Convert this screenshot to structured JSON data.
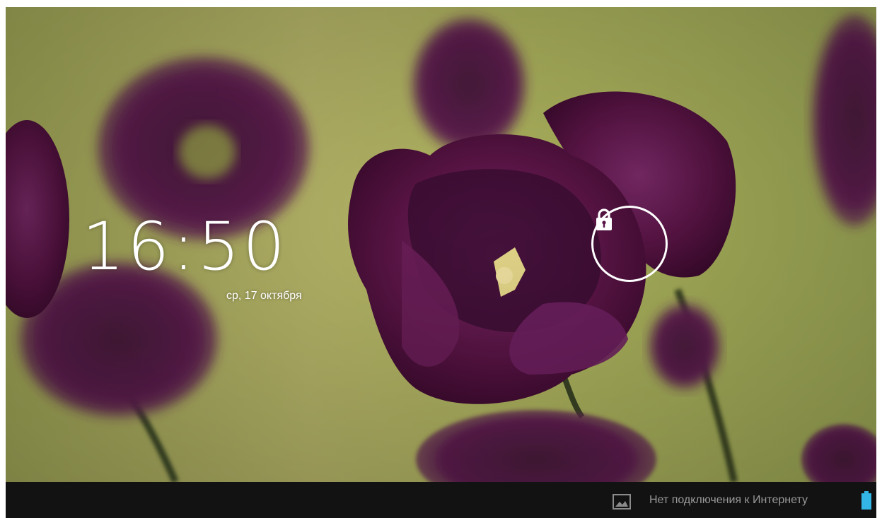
{
  "lockscreen": {
    "time": "16:50",
    "date": "ср, 17 октября"
  },
  "unlock": {
    "icon": "lock-icon"
  },
  "statusbar": {
    "notification_icon": "image-icon",
    "connection_text": "Нет подключения к Интернету",
    "battery_icon": "battery-icon",
    "battery_color": "#33b5e5"
  },
  "colors": {
    "wallpaper_green": "#aeb45e",
    "flower_purple": "#5a1446",
    "statusbar_bg": "#121212"
  }
}
